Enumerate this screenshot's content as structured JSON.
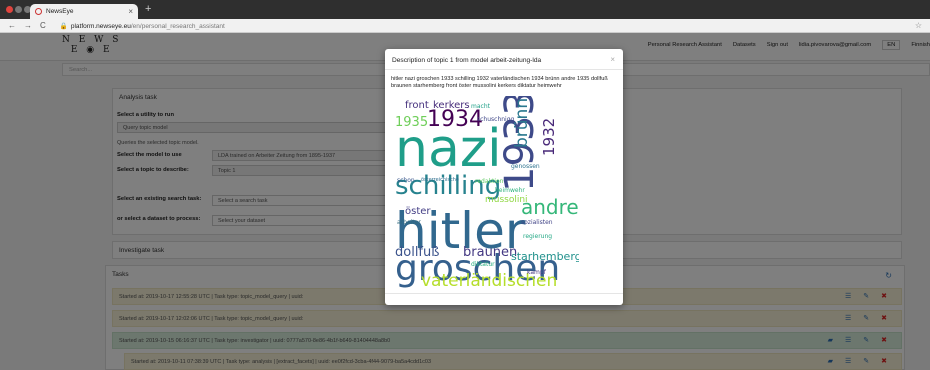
{
  "browser": {
    "tab_title": "NewsEye",
    "url_host": "platform.newseye.eu",
    "url_path": "/en/personal_research_assistant"
  },
  "page": {
    "logo_line1": "N E W S",
    "logo_line2": "E",
    "logo_line2b": "E",
    "nav": [
      "Personal Research Assistant",
      "Datasets",
      "Sign out",
      "lidia.pivovarova@gmail.com",
      "EN",
      "Finnish"
    ],
    "search_placeholder": "Search...",
    "analysis_task": {
      "title": "Analysis task",
      "utility_label": "Select a utility to run",
      "utility_value": "Query topic model",
      "utility_note": "Queries the selected topic model.",
      "model_label": "Select the model to use",
      "model_value": "LDA trained on Arbeiter Zeitung from 1895-1937",
      "topic_label": "Select a topic to describe:",
      "topic_value": "Topic 1",
      "search_task_label": "Select an existing search task:",
      "search_task_placeholder": "Select a search task",
      "dataset_label": "or select a dataset to process:",
      "dataset_placeholder": "Select your dataset"
    },
    "investigate_title": "Investigate task",
    "tasks_title": "Tasks",
    "tasks": [
      "Started at: 2019-10-17 12:55:28 UTC | Task type: topic_model_query | uuid:",
      "Started at: 2019-10-17 12:02:06 UTC | Task type: topic_model_query | uuid:",
      "Started at: 2019-10-15 06:16:37 UTC | Task type: investigator | uuid: 0777a570-8e86-4b1f-b649-81404448a8b0",
      "Started at: 2019-10-11 07:38:39 UTC | Task type: analysis | [extract_facets] | uuid: ee0f2fcd-3cba-4f44-9079-ba5a4cdd1c03"
    ]
  },
  "modal": {
    "title": "Description of topic 1 from model arbeit-zeitung-lda",
    "description": "hitler nazi groschen 1933 schilling 1932 vaterländischen 1934 brünn andre 1935 dollfuß braunen starhemberg front öster mussolini kerkers diktatur heimwehr",
    "cloud_words": [
      {
        "w": "nazi",
        "c": "#1f9e89"
      },
      {
        "w": "hitler",
        "c": "#31688e"
      },
      {
        "w": "groschen",
        "c": "#35608d"
      },
      {
        "w": "schilling",
        "c": "#26828e"
      },
      {
        "w": "1933",
        "c": "#3e4a89"
      },
      {
        "w": "1932",
        "c": "#482878"
      },
      {
        "w": "vaterländischen",
        "c": "#b5de2b"
      },
      {
        "w": "1934",
        "c": "#440154"
      },
      {
        "w": "brünn",
        "c": "#2a788e"
      },
      {
        "w": "andre",
        "c": "#35b779"
      },
      {
        "w": "1935",
        "c": "#6ece58"
      },
      {
        "w": "dollfuß",
        "c": "#3b528b"
      },
      {
        "w": "braunen",
        "c": "#443983"
      },
      {
        "w": "starhemberg",
        "c": "#21918c"
      },
      {
        "w": "front",
        "c": "#46327e"
      },
      {
        "w": "öster",
        "c": "#433e85"
      },
      {
        "w": "mussolini",
        "c": "#90d743"
      },
      {
        "w": "kerkers",
        "c": "#472d7b"
      },
      {
        "w": "genossen",
        "c": "#2c728e"
      },
      {
        "w": "sozialisten",
        "c": "#414487"
      },
      {
        "w": "arbeiter",
        "c": "#30697e"
      },
      {
        "w": "kampf",
        "c": "#453781"
      },
      {
        "w": "redaktion",
        "c": "#5ec962"
      },
      {
        "w": "diktatur",
        "c": "#28ae80"
      },
      {
        "w": "heimwehr",
        "c": "#2db27d"
      },
      {
        "w": "schuschnigg",
        "c": "#3f4788"
      },
      {
        "w": "macht",
        "c": "#1fa088"
      },
      {
        "w": "regierung",
        "c": "#22a884"
      },
      {
        "w": "schon",
        "c": "#39568c"
      },
      {
        "w": "österreichische",
        "c": "#2e6e8e"
      }
    ]
  }
}
